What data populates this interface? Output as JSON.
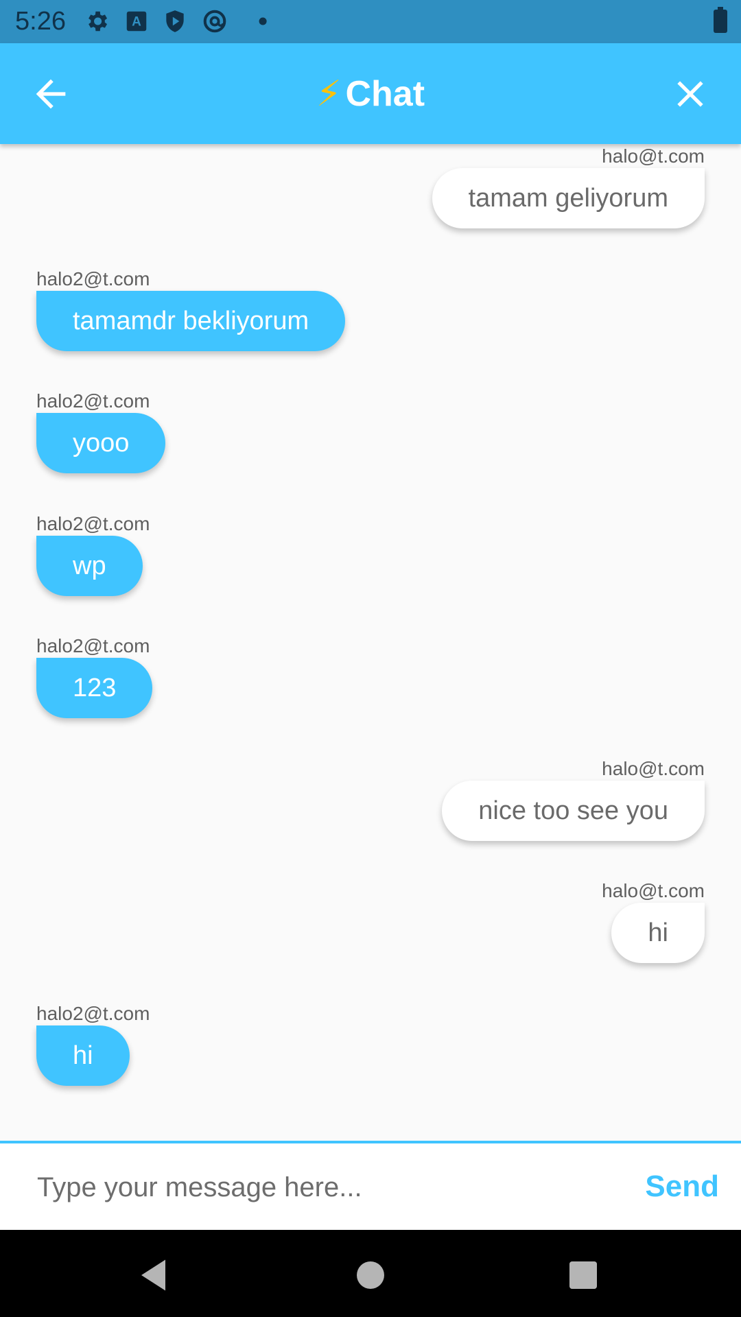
{
  "status_bar": {
    "time": "5:26",
    "icons": [
      "settings-icon",
      "text-a-icon",
      "shield-play-icon",
      "at-circle-icon",
      "dot-icon",
      "battery-icon"
    ]
  },
  "app_bar": {
    "title": "Chat",
    "title_emoji": "⚡",
    "back_icon": "arrow-left-icon",
    "close_icon": "close-icon",
    "color": "#40c4ff"
  },
  "messages": [
    {
      "sender": "halo@t.com",
      "text": "tamam geliyorum",
      "side": "right"
    },
    {
      "sender": "halo2@t.com",
      "text": "tamamdr bekliyorum",
      "side": "left"
    },
    {
      "sender": "halo2@t.com",
      "text": "yooo",
      "side": "left"
    },
    {
      "sender": "halo2@t.com",
      "text": "wp",
      "side": "left"
    },
    {
      "sender": "halo2@t.com",
      "text": "123",
      "side": "left"
    },
    {
      "sender": "halo@t.com",
      "text": "nice too see you",
      "side": "right"
    },
    {
      "sender": "halo@t.com",
      "text": "hi",
      "side": "right"
    },
    {
      "sender": "halo2@t.com",
      "text": "hi",
      "side": "left"
    }
  ],
  "composer": {
    "placeholder": "Type your message here...",
    "value": "",
    "send_label": "Send"
  },
  "nav_bar": {
    "icons": [
      "back-triangle-icon",
      "home-circle-icon",
      "recents-square-icon"
    ]
  }
}
